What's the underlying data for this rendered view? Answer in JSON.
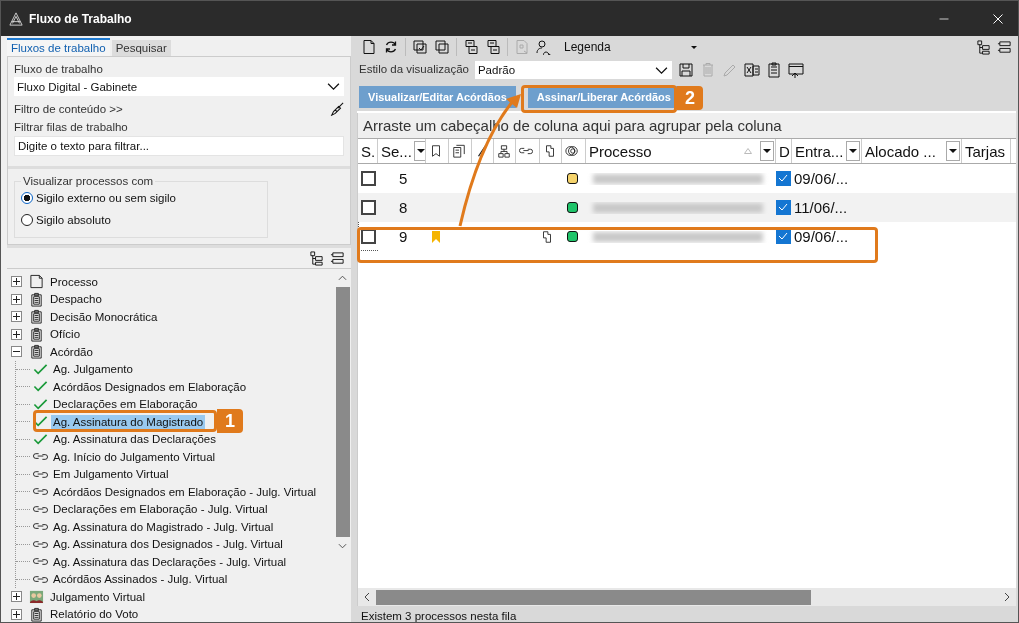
{
  "window": {
    "title": "Fluxo de Trabalho"
  },
  "left_tabs": [
    {
      "label": "Fluxos de trabalho",
      "selected": true
    },
    {
      "label": "Pesquisar",
      "selected": false
    }
  ],
  "workflow": {
    "label": "Fluxo de trabalho",
    "value": "Fluxo Digital - Gabinete"
  },
  "content_filter": {
    "label": "Filtro de conteúdo >>"
  },
  "queue_filter": {
    "label": "Filtrar filas de trabalho",
    "placeholder": "Digite o texto para filtrar..."
  },
  "visibility": {
    "legend": "Visualizar processos com",
    "options": [
      {
        "label": "Sigilo externo ou sem sigilo",
        "selected": true
      },
      {
        "label": "Sigilo absoluto",
        "selected": false
      }
    ]
  },
  "tree": [
    {
      "label": "Processo",
      "kind": "document",
      "expanded": false,
      "selected": false
    },
    {
      "label": "Despacho",
      "kind": "clipboard",
      "expanded": false,
      "selected": false
    },
    {
      "label": "Decisão Monocrática",
      "kind": "clipboard",
      "expanded": false,
      "selected": false
    },
    {
      "label": "Ofício",
      "kind": "clipboard",
      "expanded": false,
      "selected": false
    },
    {
      "label": "Acórdão",
      "kind": "clipboard",
      "expanded": true,
      "selected": false,
      "children": [
        {
          "label": "Ag. Julgamento",
          "kind": "check",
          "selected": false
        },
        {
          "label": "Acórdãos Designados em Elaboração",
          "kind": "check",
          "selected": false
        },
        {
          "label": "Declarações em Elaboração",
          "kind": "check",
          "selected": false
        },
        {
          "label": "Ag. Assinatura do Magistrado",
          "kind": "check",
          "selected": true
        },
        {
          "label": "Ag. Assinatura das Declarações",
          "kind": "check",
          "selected": false
        },
        {
          "label": "Ag. Início do Julgamento Virtual",
          "kind": "link",
          "selected": false
        },
        {
          "label": "Em Julgamento Virtual",
          "kind": "link",
          "selected": false
        },
        {
          "label": "Acórdãos Designados em Elaboração - Julg. Virtual",
          "kind": "link",
          "selected": false
        },
        {
          "label": "Declarações em Elaboração - Julg. Virtual",
          "kind": "link",
          "selected": false
        },
        {
          "label": "Ag. Assinatura do Magistrado - Julg. Virtual",
          "kind": "link",
          "selected": false
        },
        {
          "label": "Ag. Assinatura dos Designados - Julg. Virtual",
          "kind": "link",
          "selected": false
        },
        {
          "label": "Ag. Assinatura das Declarações - Julg. Virtual",
          "kind": "link",
          "selected": false
        },
        {
          "label": "Acórdãos Assinados - Julg. Virtual",
          "kind": "link",
          "selected": false
        }
      ]
    },
    {
      "label": "Julgamento Virtual",
      "kind": "people",
      "expanded": false,
      "selected": false
    },
    {
      "label": "Relatório do Voto",
      "kind": "clipboard",
      "expanded": false,
      "selected": false
    }
  ],
  "toolbar": [
    {
      "kind": "new",
      "disabled": false
    },
    {
      "kind": "refresh",
      "disabled": false
    },
    {
      "kind": "sep"
    },
    {
      "kind": "check-copy",
      "disabled": false
    },
    {
      "kind": "copy",
      "disabled": false
    },
    {
      "kind": "sep"
    },
    {
      "kind": "paste-save",
      "disabled": false
    },
    {
      "kind": "save-list",
      "disabled": false
    },
    {
      "kind": "sep"
    },
    {
      "kind": "export",
      "disabled": true
    },
    {
      "kind": "search-person",
      "disabled": false
    }
  ],
  "legend_dropdown": {
    "label": "Legenda"
  },
  "view_style": {
    "label": "Estilo da visualização",
    "value": "Padrão",
    "actions": [
      {
        "kind": "save",
        "disabled": false
      },
      {
        "kind": "delete",
        "disabled": true
      },
      {
        "kind": "edit",
        "disabled": true
      },
      {
        "kind": "excel",
        "disabled": false
      },
      {
        "kind": "report",
        "disabled": false
      },
      {
        "kind": "window-export",
        "disabled": false
      }
    ]
  },
  "action_buttons": [
    {
      "label": "Visualizar/Editar Acórdãos"
    },
    {
      "label": "Assinar/Liberar Acórdãos"
    }
  ],
  "group_hint": "Arraste um cabeçalho de coluna aqui para agrupar pela coluna",
  "columns": [
    {
      "kind": "text",
      "label": "S.",
      "filter": false
    },
    {
      "kind": "text",
      "label": "Se...",
      "filter": true
    },
    {
      "kind": "bookmark"
    },
    {
      "kind": "clip"
    },
    {
      "kind": "tick"
    },
    {
      "kind": "hierarchy"
    },
    {
      "kind": "link"
    },
    {
      "kind": "page"
    },
    {
      "kind": "rings"
    },
    {
      "kind": "text",
      "label": "Processo",
      "filter": true,
      "sorted": true
    },
    {
      "kind": "text",
      "label": "D",
      "filter": false
    },
    {
      "kind": "text",
      "label": "Entra...",
      "filter": true
    },
    {
      "kind": "text",
      "label": "Alocado ...",
      "filter": true
    },
    {
      "kind": "text",
      "label": "Tarjas",
      "filter": false
    }
  ],
  "rows": [
    {
      "checked": false,
      "seq": "5",
      "bookmark": false,
      "page": false,
      "color": "#f5d36b",
      "d_checked": true,
      "entry": "09/06/...",
      "focused": false
    },
    {
      "checked": false,
      "seq": "8",
      "bookmark": false,
      "page": false,
      "color": "#1fc46a",
      "d_checked": true,
      "entry": "11/06/...",
      "focused": false
    },
    {
      "checked": false,
      "seq": "9",
      "bookmark": true,
      "page": true,
      "color": "#1fc46a",
      "d_checked": true,
      "entry": "09/06/...",
      "focused": true
    }
  ],
  "status_bar": "Existem 3 processos nesta fila",
  "annotations": [
    {
      "label": "1"
    },
    {
      "label": "2"
    }
  ]
}
